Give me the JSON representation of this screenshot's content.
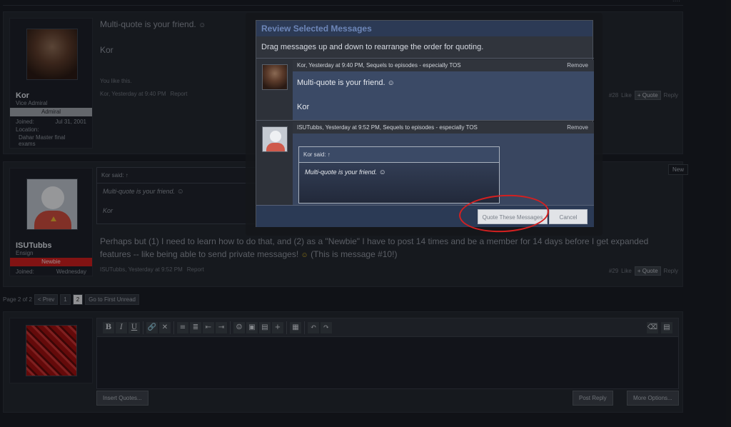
{
  "top": {
    "dots": "...."
  },
  "posts": [
    {
      "user": {
        "name": "Kor",
        "title": "Vice Admiral",
        "rank": "Admiral",
        "joined_label": "Joined:",
        "joined": "Jul 31, 2001",
        "location_label": "Location:",
        "location": "Dahar Master final exams"
      },
      "text": "Multi-quote is your friend.",
      "signature": "Kor",
      "likes": "You like this.",
      "meta": {
        "author_time": "Kor, Yesterday at 9:40 PM",
        "report": "Report"
      },
      "controls": {
        "num": "#28",
        "like": "Like",
        "quote": "+ Quote",
        "reply": "Reply"
      }
    },
    {
      "user": {
        "name": "ISUTubbs",
        "title": "Ensign",
        "rank": "Newbie",
        "joined_label": "Joined:",
        "joined": "Wednesday"
      },
      "quote": {
        "head": "Kor said: ↑",
        "body": "Multi-quote is your friend.",
        "sig": "Kor"
      },
      "text": "Perhaps but (1) I need to learn how to do that, and (2) as a \"Newbie\" I have to post 14 times and be a member for 14 days before I get expanded features -- like being able to send private messages!",
      "text_tail": "(This is message #10!)",
      "meta": {
        "author_time": "ISUTubbs, Yesterday at 9:52 PM",
        "report": "Report"
      },
      "controls": {
        "num": "#29",
        "like": "Like",
        "quote": "+ Quote",
        "reply": "Reply"
      },
      "new_tag": "New"
    }
  ],
  "pagination": {
    "label": "Page 2 of 2",
    "prev": "< Prev",
    "p1": "1",
    "p2": "2",
    "unread": "Go to First Unread"
  },
  "reply": {
    "insert_quotes": "Insert Quotes...",
    "post_reply": "Post Reply",
    "more_options": "More Options..."
  },
  "toolbar": {
    "bold": "B",
    "italic": "I",
    "underline": "U"
  },
  "modal": {
    "title": "Review Selected Messages",
    "instructions": "Drag messages up and down to rearrange the order for quoting.",
    "items": [
      {
        "header": "Kor, Yesterday at 9:40 PM, Sequels to episodes - especially TOS",
        "remove": "Remove",
        "text": "Multi-quote is your friend.",
        "sig": "Kor"
      },
      {
        "header": "ISUTubbs, Yesterday at 9:52 PM, Sequels to episodes - especially TOS",
        "remove": "Remove",
        "quote_head": "Kor said: ↑",
        "quote_body": "Multi-quote is your friend."
      }
    ],
    "quote_button": "Quote These Messages",
    "cancel_button": "Cancel"
  },
  "icons": {
    "emoji": "☺",
    "annotation_color": "#d42020"
  }
}
